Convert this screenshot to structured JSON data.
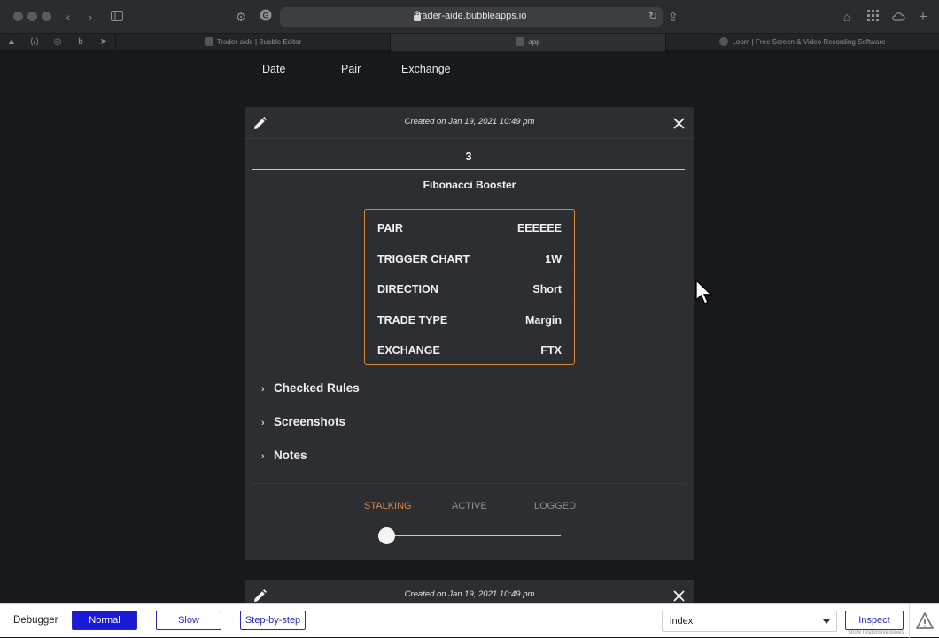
{
  "browser": {
    "url": "trader-aide.bubbleapps.io",
    "tabs": [
      {
        "label": "Trader-aide | Bubble Editor"
      },
      {
        "label": "app"
      },
      {
        "label": "Loom | Free Screen & Video Recording Software"
      }
    ]
  },
  "sort_bar": {
    "date": "Date",
    "pair": "Pair",
    "exchange": "Exchange"
  },
  "trade_card": {
    "created": "Created on Jan 19, 2021 10:49 pm",
    "count": "3",
    "strategy": "Fibonacci Booster",
    "details": [
      {
        "label": "PAIR",
        "value": "EEEEEE"
      },
      {
        "label": "TRIGGER CHART",
        "value": "1W"
      },
      {
        "label": "DIRECTION",
        "value": "Short"
      },
      {
        "label": "TRADE TYPE",
        "value": "Margin"
      },
      {
        "label": "EXCHANGE",
        "value": "FTX"
      }
    ],
    "sections": {
      "checked_rules": "Checked Rules",
      "screenshots": "Screenshots",
      "notes": "Notes"
    },
    "status": {
      "stalking": "STALKING",
      "active": "ACTIVE",
      "logged": "LOGGED",
      "current": "STALKING",
      "slider_position": 0
    }
  },
  "next_card": {
    "created": "Created on Jan 19, 2021 10:49 pm"
  },
  "debugger": {
    "label": "Debugger",
    "normal": "Normal",
    "slow": "Slow",
    "step": "Step-by-step",
    "select_value": "index",
    "inspect": "Inspect",
    "hint": "Show responsive boxes"
  },
  "colors": {
    "accent": "#d9893f",
    "card_bg": "#2d2e32",
    "page_bg": "#18191c",
    "debug_primary": "#1a1ad6"
  }
}
